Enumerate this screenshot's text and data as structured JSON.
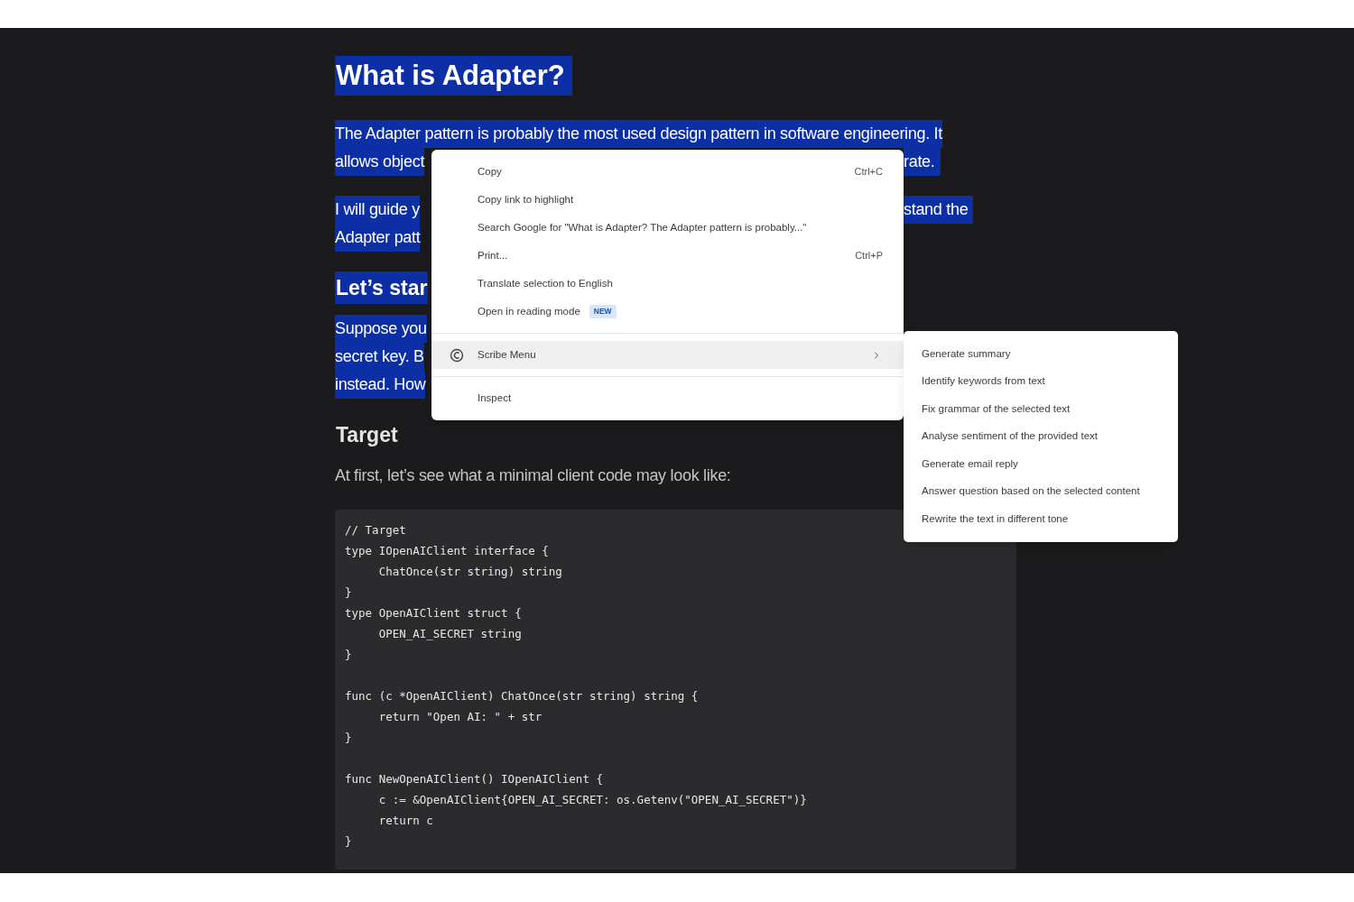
{
  "article": [
    {
      "kind": "heading",
      "text": "What is Adapter?",
      "selected": true
    },
    {
      "kind": "paragraph",
      "selected": true,
      "lines": [
        {
          "left": "The Adapter pattern is probably the most used design pattern in software engineering. It"
        },
        {
          "left": "allows object",
          "right": "rate."
        }
      ]
    },
    {
      "kind": "paragraph",
      "selected": true,
      "lines": [
        {
          "left": "I will guide y",
          "right": "stand the"
        },
        {
          "left": "Adapter patt"
        }
      ]
    },
    {
      "kind": "subheading",
      "text": "Let’s star",
      "selected": true
    },
    {
      "kind": "paragraph",
      "selected": true,
      "lines": [
        {
          "left": "Suppose you"
        },
        {
          "left": "secret key. B"
        },
        {
          "left": "instead. How"
        }
      ]
    },
    {
      "kind": "subheading",
      "text": "Target",
      "selected": false
    },
    {
      "kind": "paragraph",
      "selected": false,
      "lines": [
        {
          "left": "At first, let’s see what a minimal client code may look like:"
        }
      ]
    },
    {
      "kind": "code",
      "text": "// Target\ntype IOpenAIClient interface {\n\tChatOnce(str string) string\n}\ntype OpenAIClient struct {\n\tOPEN_AI_SECRET string\n}\n\nfunc (c *OpenAIClient) ChatOnce(str string) string {\n\treturn \"Open AI: \" + str\n}\n\nfunc NewOpenAIClient() IOpenAIClient {\n\tc := &OpenAIClient{OPEN_AI_SECRET: os.Getenv(\"OPEN_AI_SECRET\")}\n\treturn c\n}"
    }
  ],
  "context_menu": {
    "items": [
      {
        "kind": "item",
        "label": "Copy",
        "shortcut": "Ctrl+C"
      },
      {
        "kind": "item",
        "label": "Copy link to highlight"
      },
      {
        "kind": "item",
        "label": "Search Google for \"What is Adapter? The Adapter pattern is probably...\""
      },
      {
        "kind": "item",
        "label": "Print...",
        "shortcut": "Ctrl+P"
      },
      {
        "kind": "item",
        "label": "Translate selection to English"
      },
      {
        "kind": "item",
        "label": "Open in reading mode",
        "badge": "NEW"
      },
      {
        "kind": "separator"
      },
      {
        "kind": "submenu",
        "label": "Scribe Menu",
        "highlighted": true
      },
      {
        "kind": "separator"
      },
      {
        "kind": "item",
        "label": "Inspect"
      }
    ]
  },
  "submenu": {
    "items": [
      {
        "label": "Generate summary"
      },
      {
        "label": "Identify keywords from text"
      },
      {
        "label": "Fix grammar of the selected text"
      },
      {
        "label": "Analyse sentiment of the provided text"
      },
      {
        "label": "Generate email reply"
      },
      {
        "label": "Answer question based on the selected content"
      },
      {
        "label": "Rewrite the text in different tone"
      }
    ]
  }
}
